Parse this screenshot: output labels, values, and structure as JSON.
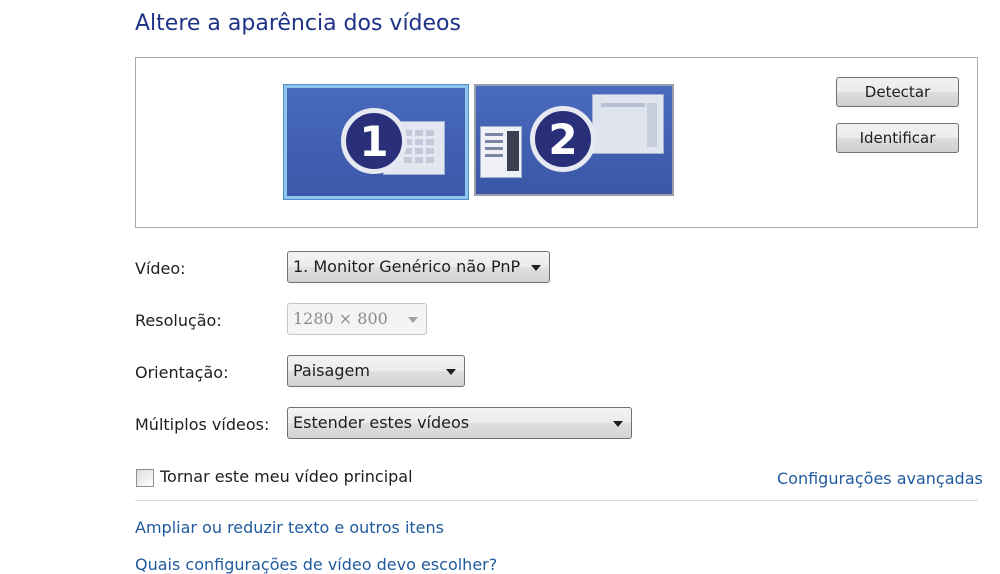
{
  "header": {
    "title": "Altere a aparência dos vídeos"
  },
  "preview": {
    "monitors": [
      {
        "number": "1",
        "selected": true
      },
      {
        "number": "2",
        "selected": false
      }
    ],
    "detect_label": "Detectar",
    "identify_label": "Identificar"
  },
  "settings": {
    "video_label": "Vídeo:",
    "video_value": "1. Monitor Genérico não PnP",
    "resolution_label": "Resolução:",
    "resolution_value": "1280 × 800",
    "orientation_label": "Orientação:",
    "orientation_value": "Paisagem",
    "multiple_label": "Múltiplos vídeos:",
    "multiple_value": "Estender estes vídeos"
  },
  "primary_checkbox": {
    "label": "Tornar este meu vídeo principal",
    "checked": false
  },
  "links": {
    "advanced": "Configurações avançadas",
    "text_size": "Ampliar ou reduzir texto e outros itens",
    "which_settings": "Quais configurações de vídeo devo escolher?"
  },
  "colors": {
    "title": "#1e3287",
    "link": "#1f5a9e",
    "monitor_selected_border": "#8fc6ee"
  }
}
